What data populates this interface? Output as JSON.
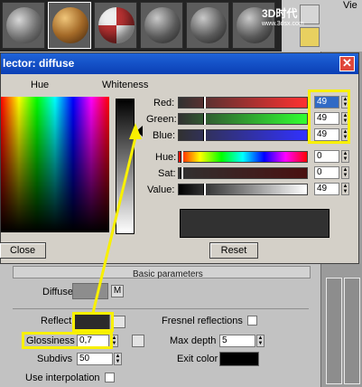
{
  "top": {
    "viewport_tab": "Vie",
    "watermark": "3D时代",
    "watermark_sub": "www.3dsx.com"
  },
  "dialog": {
    "title": "lector: diffuse",
    "hue_label": "Hue",
    "whiteness_label": "Whiteness",
    "channels": [
      {
        "label": "Red:",
        "value": "49"
      },
      {
        "label": "Green:",
        "value": "49"
      },
      {
        "label": "Blue:",
        "value": "49"
      }
    ],
    "hsv": [
      {
        "label": "Hue:",
        "value": "0"
      },
      {
        "label": "Sat:",
        "value": "0"
      },
      {
        "label": "Value:",
        "value": "49"
      }
    ],
    "close_label": "Close",
    "reset_label": "Reset",
    "preview_color": "#313131"
  },
  "basic": {
    "header": "Basic parameters",
    "diffuse_label": "Diffuse",
    "map_button": "M",
    "reflect_label": "Reflect",
    "fresnel_label": "Fresnel reflections",
    "glossiness_label": "Glossiness",
    "glossiness_value": "0,7",
    "max_depth_label": "Max depth",
    "max_depth_value": "5",
    "subdivs_label": "Subdivs",
    "subdivs_value": "50",
    "exit_color_label": "Exit color",
    "use_interp_label": "Use interpolation"
  },
  "colors": {
    "highlight": "#f8f000",
    "title_bar": "#0a3fb5",
    "reflect_swatch": "#2b2b2b",
    "exit_color": "#000000",
    "diffuse_swatch": "#8d8d8d"
  }
}
